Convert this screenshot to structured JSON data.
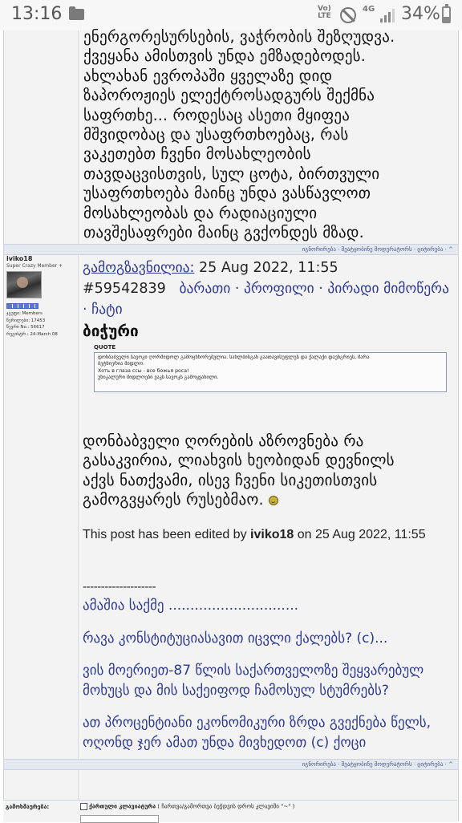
{
  "status_bar": {
    "time": "13:16",
    "volte": "Vo)) LTE",
    "network": "4G",
    "battery_percent": "34%",
    "battery_level": 0.34
  },
  "previous_post": {
    "lines": [
      "ენერგორესურსების, ვაჭრობის შეზღუდვა.",
      "ქვეყანა ამისთვის უნდა ემზადებოდეს.",
      "ახლახან ევროპაში ყველაზე დიდ",
      "ზაპოროჟიეს ელექტროსადგურს შექმნა",
      "საფრთხე... როდესაც ასეთი მყიფეა",
      "მშვიდობაც და უსაფრთხოებაც, რას",
      "ვაკეთებთ ჩვენი მოსახლეობის",
      "თავდაცვისთვის, სულ ცოტა, ბირთვული",
      "უსაფრთხოება მაინც უნდა ვასწავლოთ",
      "მოსახლეობას და რადიაციული",
      "თავშესაფრები მაინც გვქონდეს მზად."
    ]
  },
  "post_actions": "იგნორირება · შეატყობინე მოდერატორს · ციტირება · ^",
  "author": {
    "name": "iviko18",
    "rank": "Super Crazy Member +",
    "stats": [
      "ჯგუფი: Members",
      "წერილები: 17453",
      "წევრი No.: 56617",
      "რეგისტრ.: 24-March 08"
    ]
  },
  "post": {
    "sent_label": "გამოგზავნილია:",
    "date": " 25 Aug 2022, 11:55",
    "number": "#59542839",
    "links": "ბარათი · პროფილი · პირადი მიმოწერა · ჩატი",
    "title": "ბიჭური",
    "quote_label": "QUOTE",
    "quote_lines": [
      "დონბაბველი სავოკი ღორმიდოლ გამოცხნორებულია. სახლბისგან გაათავისუფლეს და ქალაქი დაუნგრიეს, მარა",
      "ბეტნიერია მიდლო.",
      "Хоть в глаза ссы - все божья роса!",
      "",
      "უნიკალური მიდლოები ვაკს სავოკს გამოყვანილი."
    ],
    "body_lines": [
      "დონბაბველი ღორების აზროვნება რა",
      "გასაკვირია, ლიახვის ხეობიდან დევნილს",
      "აქვს ნათქვამი, ისევ ჩვენი სიკეთისთვის",
      "გამოგვყარეს რუსებმაო."
    ],
    "edit_prefix": "This post has been edited by ",
    "edit_user": "iviko18",
    "edit_suffix": " on 25 Aug 2022, 11:55"
  },
  "signature": {
    "dashes": "--------------------",
    "items": [
      "ამაშია საქმე ..............................",
      "რავა კონსტიტუციასავით იცვლი ქალებს? (c)...",
      "ვის მოერიეთ-87 წლის საქართველოზე შეყვარებულ მოხუცს და მის საქეიფოდ ჩამოსულ სტუმრებს?",
      "ათ პროცენტიანი ეკონომიკური ზრდა გვექნება წელს, ოღონდ ჯერ ამათ უნდა მივხედოთ (c) ქოცი"
    ]
  },
  "footer": {
    "label": "გამოხმაურება:",
    "keyboard_label": "ქართული კლავიატურა",
    "keyboard_hint": "( ჩართვა/გამორთვა ბეჭდვის დროს კლავიში \"~\" )"
  }
}
